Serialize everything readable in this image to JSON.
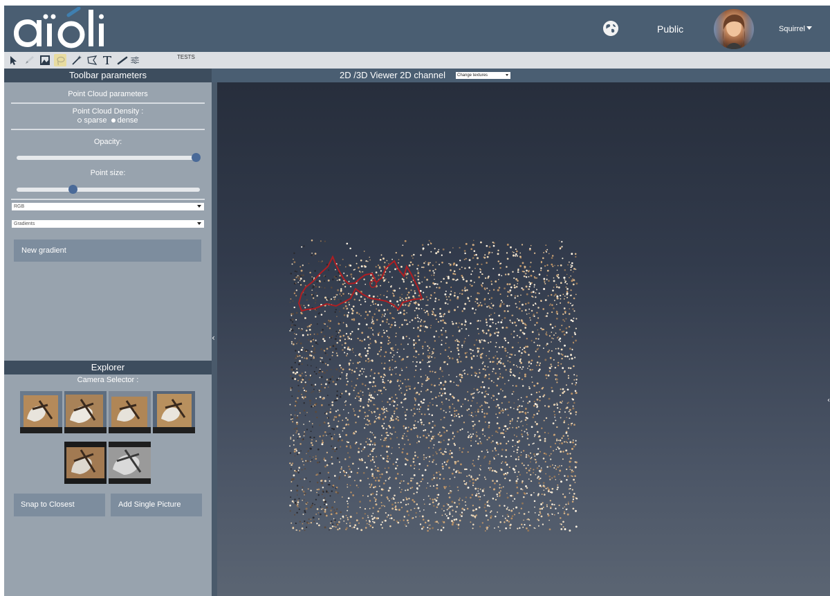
{
  "header": {
    "logo_text": "aïóli",
    "visibility_label": "Public",
    "user_name": "Squirrel"
  },
  "toolbar": {
    "tools": [
      "pointer-tool",
      "pen-tool",
      "image-tool",
      "lasso-tool",
      "magic-wand-tool",
      "polygon-tool",
      "text-tool",
      "line-tool",
      "sliders-tool"
    ],
    "tests_label": "TESTS"
  },
  "left_panel": {
    "title": "Toolbar parameters",
    "section_title": "Point Cloud parameters",
    "density_label": "Point Cloud Density :",
    "density_options": [
      "sparse",
      "dense"
    ],
    "density_selected": "dense",
    "opacity_label": "Opacity:",
    "opacity_value": 1.0,
    "point_size_label": "Point size:",
    "point_size_value": 0.3,
    "color_select": "RGB",
    "gradient_select": "Gradients",
    "new_gradient_label": "New gradient"
  },
  "explorer": {
    "title": "Explorer",
    "camera_label": "Camera Selector :",
    "camera_count": 6,
    "snap_label": "Snap to Closest",
    "add_label": "Add Single Picture"
  },
  "viewer": {
    "title": "2D /3D Viewer 2D channel",
    "texture_select": "Change textures"
  },
  "colors": {
    "header_bg": "#4a5e72",
    "panel_bg": "#98a3ae",
    "accent": "#4a6a98",
    "selection_outline": "#b01e22"
  }
}
